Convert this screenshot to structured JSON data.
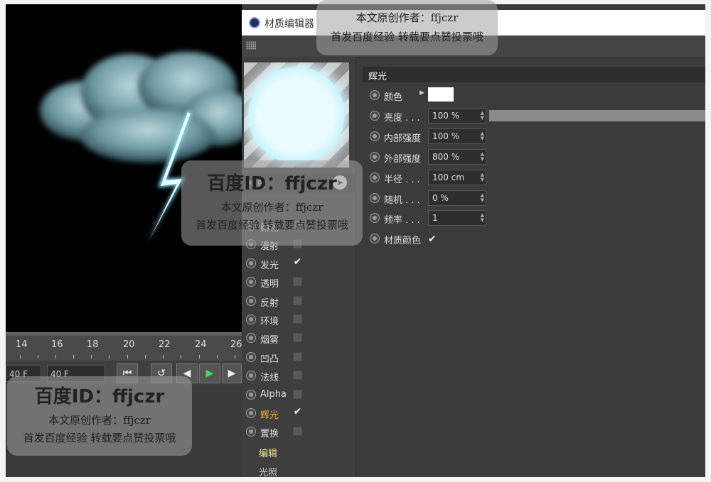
{
  "timeline": {
    "ticks": [
      "14",
      "16",
      "18",
      "20",
      "22",
      "24",
      "26"
    ],
    "start_field": "40 F",
    "end_field": "40 F"
  },
  "editor": {
    "title": "材质编辑器",
    "material_name_label": "材质",
    "channels": [
      {
        "label": "颜色",
        "checked": false
      },
      {
        "label": "漫射",
        "checked": false
      },
      {
        "label": "发光",
        "checked": true
      },
      {
        "label": "透明",
        "checked": false
      },
      {
        "label": "反射",
        "checked": false
      },
      {
        "label": "环境",
        "checked": false
      },
      {
        "label": "烟雾",
        "checked": false
      },
      {
        "label": "凹凸",
        "checked": false
      },
      {
        "label": "法线",
        "checked": false
      },
      {
        "label": "Alpha",
        "checked": false
      },
      {
        "label": "辉光",
        "checked": true,
        "active": true
      },
      {
        "label": "置换",
        "checked": false
      }
    ],
    "sub_links": [
      "编辑",
      "光照"
    ],
    "section_title": "辉光",
    "props": {
      "color": {
        "label": "颜色",
        "value": "#ffffff"
      },
      "brightness": {
        "label": "亮度 . . .",
        "value": "100 %"
      },
      "inner_strength": {
        "label": "内部强度",
        "value": "100 %"
      },
      "outer_strength": {
        "label": "外部强度",
        "value": "800 %"
      },
      "radius": {
        "label": "半径 . . .",
        "value": "100 cm"
      },
      "random": {
        "label": "随机 . . .",
        "value": "0 %"
      },
      "frequency": {
        "label": "频率 . . .",
        "value": "1"
      },
      "material_color": {
        "label": "材质颜色",
        "checked": true
      }
    }
  },
  "watermark": {
    "id": "百度ID：ffjczr",
    "line1": "本文原创作者：ffjczr",
    "line2": "首发百度经验 转载要点赞投票哦"
  },
  "colors": {
    "glow": "#dff8ff",
    "active_channel": "#f0b23a",
    "sub_link": "#f3e08a"
  }
}
